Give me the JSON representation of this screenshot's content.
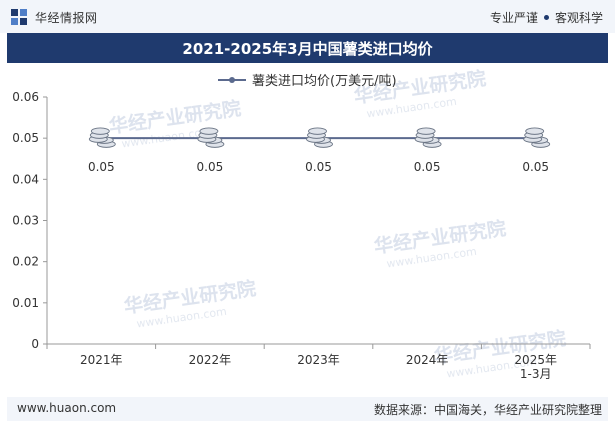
{
  "header": {
    "brand": "华经情报网",
    "tag1": "专业严谨",
    "tag2": "客观科学"
  },
  "title": "2021-2025年3月中国薯类进口均价",
  "footer": {
    "website": "www.huaon.com",
    "source": "数据来源：中国海关，华经产业研究院整理"
  },
  "watermark": {
    "text": "华经产业研究院",
    "url": "www.huaon.com"
  },
  "colors": {
    "title_bg": "#1f3a6e",
    "line": "#5b6a8e",
    "accent": "#1f3a6e"
  },
  "chart_data": {
    "type": "line",
    "legend": "top-center",
    "grid": false,
    "categories": [
      "2021年",
      "2022年",
      "2023年",
      "2024年",
      "2025年\n1-3月"
    ],
    "series": [
      {
        "name": "薯类进口均价(万美元/吨)",
        "values": [
          0.05,
          0.05,
          0.05,
          0.05,
          0.05
        ],
        "labels": [
          "0.05",
          "0.05",
          "0.05",
          "0.05",
          "0.05"
        ],
        "marker": "coin-stack-icon"
      }
    ],
    "ylim": [
      0,
      0.06
    ],
    "yticks": [
      "0",
      "0.01",
      "0.02",
      "0.03",
      "0.04",
      "0.05",
      "0.06"
    ]
  }
}
